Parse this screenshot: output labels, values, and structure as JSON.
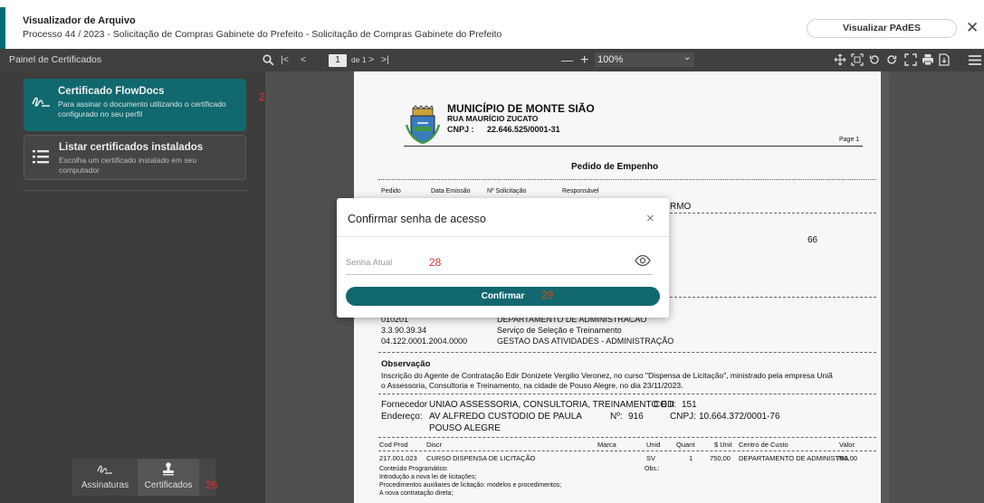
{
  "window": {
    "title": "Visualizador de Arquivo",
    "subtitle": "Processo 44 / 2023 - Solicitação de Compras Gabinete do Prefeito - Solicitação de Compras Gabinete do Prefeito",
    "pades_button": "Visualizar PAdES",
    "close_glyph": "✕"
  },
  "toolbar": {
    "panel_label": "Painel de Certificados",
    "current_page": "1",
    "page_of": "de 1",
    "zoom": "100%",
    "nav_first": "|<",
    "nav_prev": "<",
    "nav_next": ">",
    "nav_last": ">|",
    "zoom_out": "—",
    "zoom_in": "+",
    "select_arrow": "⌄"
  },
  "panel": {
    "card_flowdocs": {
      "title": "Certificado FlowDocs",
      "desc": "Para assinar o documento utilizando o certificado configurado no seu perfil",
      "icon": "signature-icon"
    },
    "card_list": {
      "title": "Listar certificados instalados",
      "desc": "Escolha um certificado instalado em seu computador",
      "icon": "list-icon"
    },
    "annotations": {
      "a27": "27",
      "a26": "26",
      "a28": "28",
      "a29": "29"
    }
  },
  "bottom_nav": {
    "assinaturas": {
      "label": "Assinaturas",
      "icon": "signature-icon"
    },
    "certificados": {
      "label": "Certificados",
      "icon": "stamp-icon"
    }
  },
  "document": {
    "org_name": "MUNICÍPIO DE MONTE SIÃO",
    "address": "RUA MAURÍCIO ZUCATO",
    "cnpj_label": "CNPJ :",
    "cnpj": "22.646.525/0001-31",
    "page_label": "Page 1",
    "doc_title": "Pedido de Empenho",
    "col_pedido": "Pedido",
    "col_emissao": "Data Emissão",
    "col_solicitacao": "Nº Solicitação",
    "col_responsavel": "Responsável",
    "partial_resp": "RMO",
    "partial_num": "66",
    "dot_1": "010201",
    "dot_1_desc": "DEPARTAMENTO DE ADMINISTRACAO",
    "dot_2": "3.3.90.39.34",
    "dot_2_desc": "Serviço de Seleção e Treinamento",
    "dot_3": "04.122.0001.2004.0000",
    "dot_3_desc": "GESTAO DAS ATIVIDADES - ADMINISTRAÇÃO",
    "obs_label": "Observação",
    "obs_line1": "Inscrição do Agente de Contratação Edir Donizete Vergilio Veronez, no curso \"Dispensa de Licitação\", ministrado pela empresa Uniã",
    "obs_line2": "o Assessoria, Consultoria e Treinamento, na cidade de Pouso Alegre, no dia 23/11/2023.",
    "fornecedor_label": "Fornecedor",
    "fornecedor": "UNIAO ASSESSORIA, CONSULTORIA, TREINAMENTO E II",
    "cod_label": "COD:",
    "cod": "151",
    "endereco_label": "Endereço:",
    "endereco": "AV ALFREDO CUSTODIO DE PAULA",
    "numero_label": "Nº:",
    "numero": "916",
    "cnpj2_label": "CNPJ:",
    "cnpj2": "10.664.372/0001-76",
    "cidade": "POUSO ALEGRE",
    "items_header": {
      "cod": "Cod Prod",
      "disc": "Discr",
      "marca": "Marca",
      "unid": "Unid",
      "quant": "Quant",
      "unit": "$ Unit",
      "centro": "Centro de Custo",
      "valor": "Valor"
    },
    "item": {
      "cod": "217.001.023",
      "disc": "CURSO DISPENSA DE LICITAÇÃO",
      "unid": "SV",
      "quant": "1",
      "unit": "750,00",
      "centro": "DEPARTAMENTO DE ADMINISTRA",
      "valor": "750,00"
    },
    "conteudo_label": "Conteúdo Programático:",
    "obs_short": "Obs.:",
    "conteudo1": "Introdução a nova lei de licitações;",
    "conteudo2": "Procedimentos auxiliares de licitação: modelos e procedimentos;",
    "conteudo3": "A nova contratação direta;"
  },
  "modal": {
    "title": "Confirmar senha de acesso",
    "close_glyph": "×",
    "field_placeholder": "Senha Atual",
    "confirm_button": "Confirmar",
    "eye_icon": "eye-icon"
  },
  "colors": {
    "primary": "#11686e",
    "panel": "#3d3d3d",
    "toolbar": "#404040",
    "annotation": "#e4312b"
  }
}
